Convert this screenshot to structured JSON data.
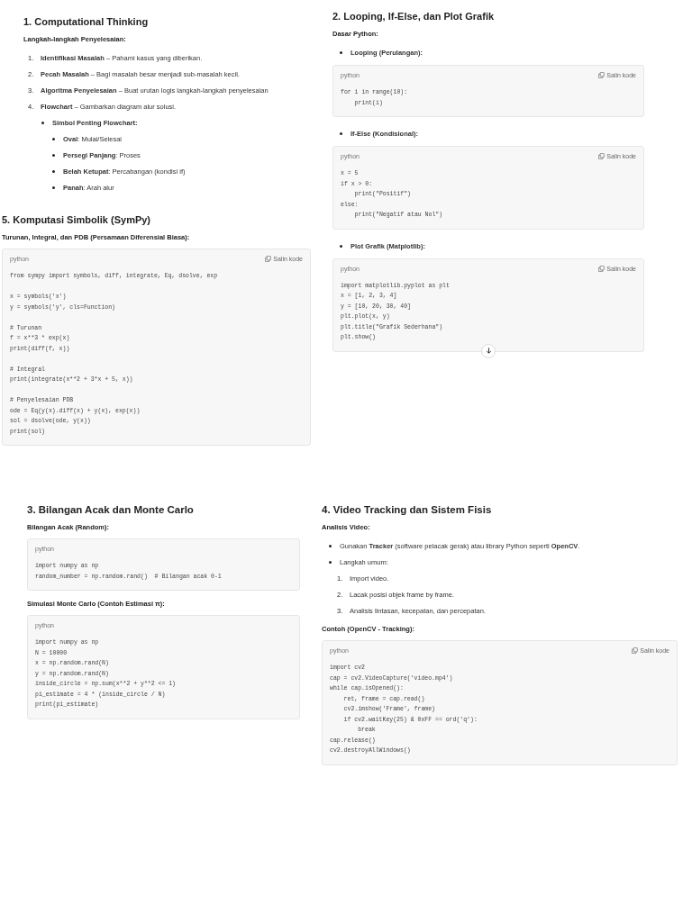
{
  "panels": [
    {
      "title": "1. Computational Thinking",
      "blocks": [
        {
          "kind": "subheading",
          "text": "Langkah-langkah Penyelesaian:"
        },
        {
          "kind": "list",
          "items": [
            {
              "number": "1.",
              "text": "**Identifikasi Masalah** – Pahami kasus yang diberikan."
            },
            {
              "number": "2.",
              "text": "**Pecah Masalah** – Bagi masalah besar menjadi sub-masalah kecil."
            },
            {
              "number": "3.",
              "text": "**Algoritma Penyelesaian** – Buat urutan logis langkah-langkah penyelesaian"
            },
            {
              "number": "4.",
              "text": "**Flowchart** – Gambarkan diagram alur solusi.",
              "children": [
                {
                  "text": "**Simbol Penting Flowchart:**",
                  "children": [
                    {
                      "text": "**Oval**: Mulai/Selesai"
                    },
                    {
                      "text": "**Persegi Panjang**: Proses"
                    },
                    {
                      "text": "**Belah Ketupat**: Percabangan (kondisi if)"
                    },
                    {
                      "text": "**Panah**: Arah alur"
                    }
                  ]
                }
              ]
            }
          ]
        }
      ]
    },
    {
      "title": "5. Komputasi Simbolik (SymPy)",
      "blocks": [
        {
          "kind": "subheading",
          "text": "Turunan, Integral, dan PDB (Persamaan Diferensial Biasa):"
        },
        {
          "kind": "code",
          "language": "python",
          "copy_label": "Salin kode",
          "paragraphs": [
            [
              "from sympy import symbols, diff, integrate, Eq, dsolve, exp"
            ],
            [
              "x = symbols('x')",
              "y = symbols('y', cls=Function)"
            ],
            [
              "# Turunan",
              "f = x**3 * exp(x)",
              "print(diff(f, x))"
            ],
            [
              "# Integral",
              "print(integrate(x**2 + 3*x + 5, x))"
            ],
            [
              "# Penyelesaian PDB",
              "ode = Eq(y(x).diff(x) + y(x), exp(x))",
              "sol = dsolve(ode, y(x))",
              "print(sol)"
            ]
          ]
        }
      ]
    },
    {
      "title": "2. Looping, If-Else, dan Plot Grafik",
      "blocks": [
        {
          "kind": "subheading",
          "text": "Dasar Python:"
        },
        {
          "kind": "list",
          "items": [
            {
              "text": "**Looping (Perulangan):**"
            }
          ]
        },
        {
          "kind": "code",
          "language": "python",
          "copy_label": "Salin kode",
          "lines": [
            "for i in range(10):",
            "    print(i)"
          ]
        },
        {
          "kind": "list",
          "items": [
            {
              "text": "**If-Else (Kondisional):**"
            }
          ]
        },
        {
          "kind": "code",
          "language": "python",
          "copy_label": "Salin kode",
          "lines": [
            "x = 5",
            "if x > 0:",
            "    print(\"Positif\")",
            "else:",
            "    print(\"Negatif atau Nol\")"
          ]
        },
        {
          "kind": "list",
          "items": [
            {
              "text": "**Plot Grafik (Matplotlib):**"
            }
          ]
        },
        {
          "kind": "code",
          "language": "python",
          "copy_label": "Salin kode",
          "scroll_down": true,
          "lines": [
            "import matplotlib.pyplot as plt",
            "x = [1, 2, 3, 4]",
            "y = [10, 20, 30, 40]",
            "plt.plot(x, y)",
            "plt.title(\"Grafik Sederhana\")",
            "plt.show()"
          ]
        }
      ]
    },
    {
      "title": "3. Bilangan Acak dan Monte Carlo",
      "blocks": [
        {
          "kind": "subheading",
          "text": "Bilangan Acak (Random):"
        },
        {
          "kind": "code",
          "language": "python",
          "lines": [
            "import numpy as np",
            "random_number = np.random.rand()  # Bilangan acak 0-1"
          ]
        },
        {
          "kind": "subheading",
          "text": "Simulasi Monte Carlo (Contoh Estimasi π):"
        },
        {
          "kind": "code",
          "language": "python",
          "lines": [
            "import numpy as np",
            "N = 10000",
            "x = np.random.rand(N)",
            "y = np.random.rand(N)",
            "inside_circle = np.sum(x**2 + y**2 <= 1)",
            "pi_estimate = 4 * (inside_circle / N)",
            "print(pi_estimate)"
          ]
        }
      ]
    },
    {
      "title": "4. Video Tracking dan Sistem Fisis",
      "blocks": [
        {
          "kind": "subheading",
          "text": "Analisis Video:"
        },
        {
          "kind": "list",
          "items": [
            {
              "text": "Gunakan **Tracker** (software pelacak gerak) atau library Python seperti **OpenCV**."
            },
            {
              "text": "Langkah umum:",
              "children": [
                {
                  "number": "1.",
                  "text": "Import video."
                },
                {
                  "number": "2.",
                  "text": "Lacak posisi objek frame by frame."
                },
                {
                  "number": "3.",
                  "text": "Analisis lintasan, kecepatan, dan percepatan."
                }
              ]
            }
          ]
        },
        {
          "kind": "subheading",
          "text": "Contoh (OpenCV - Tracking):"
        },
        {
          "kind": "code",
          "language": "python",
          "copy_label": "Salin kode",
          "lines": [
            "import cv2",
            "cap = cv2.VideoCapture('video.mp4')",
            "while cap.isOpened():",
            "    ret, frame = cap.read()",
            "    cv2.imshow('Frame', frame)",
            "    if cv2.waitKey(25) & 0xFF == ord('q'):",
            "        break",
            "cap.release()",
            "cv2.destroyAllWindows()"
          ]
        }
      ]
    }
  ]
}
